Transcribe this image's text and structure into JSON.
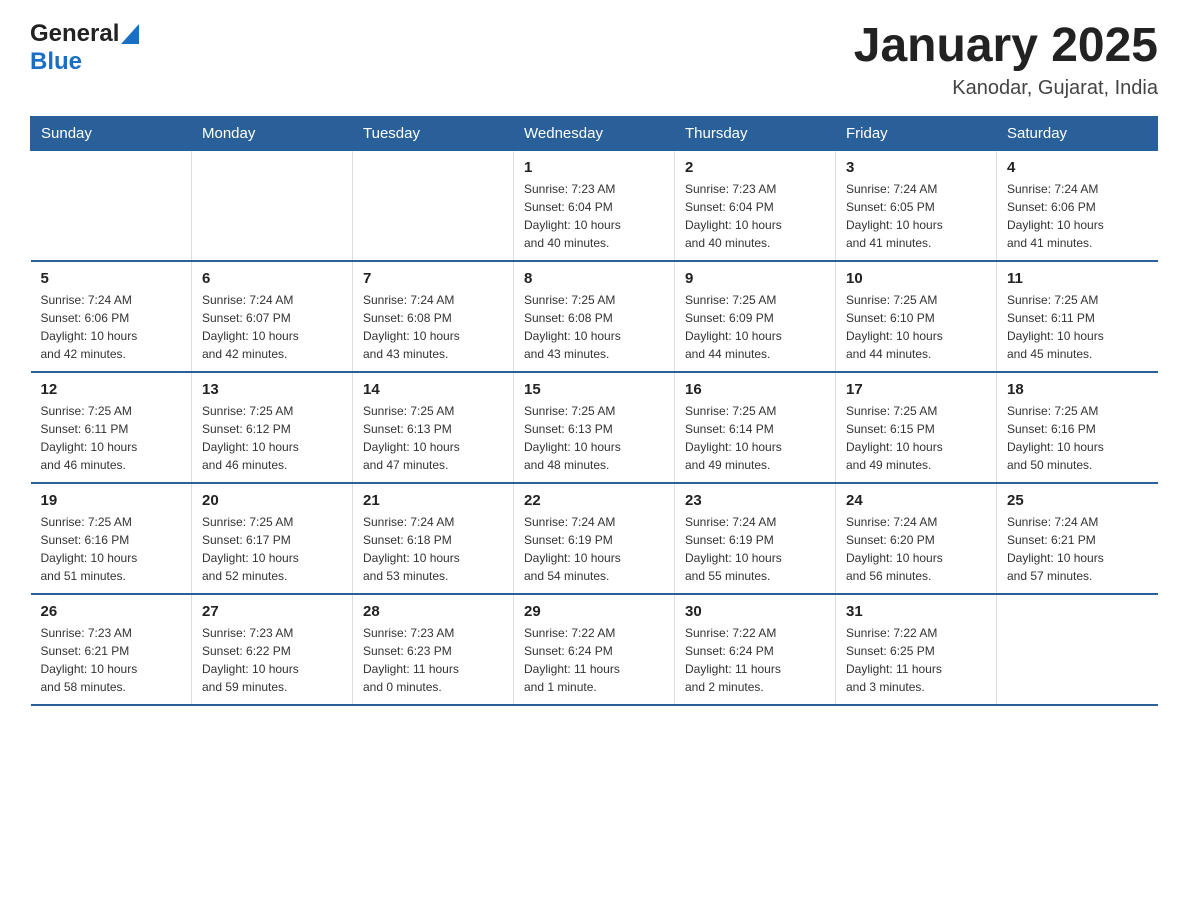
{
  "header": {
    "logo_general": "General",
    "logo_blue": "Blue",
    "title": "January 2025",
    "subtitle": "Kanodar, Gujarat, India"
  },
  "days_of_week": [
    "Sunday",
    "Monday",
    "Tuesday",
    "Wednesday",
    "Thursday",
    "Friday",
    "Saturday"
  ],
  "weeks": [
    [
      {
        "day": "",
        "info": ""
      },
      {
        "day": "",
        "info": ""
      },
      {
        "day": "",
        "info": ""
      },
      {
        "day": "1",
        "info": "Sunrise: 7:23 AM\nSunset: 6:04 PM\nDaylight: 10 hours\nand 40 minutes."
      },
      {
        "day": "2",
        "info": "Sunrise: 7:23 AM\nSunset: 6:04 PM\nDaylight: 10 hours\nand 40 minutes."
      },
      {
        "day": "3",
        "info": "Sunrise: 7:24 AM\nSunset: 6:05 PM\nDaylight: 10 hours\nand 41 minutes."
      },
      {
        "day": "4",
        "info": "Sunrise: 7:24 AM\nSunset: 6:06 PM\nDaylight: 10 hours\nand 41 minutes."
      }
    ],
    [
      {
        "day": "5",
        "info": "Sunrise: 7:24 AM\nSunset: 6:06 PM\nDaylight: 10 hours\nand 42 minutes."
      },
      {
        "day": "6",
        "info": "Sunrise: 7:24 AM\nSunset: 6:07 PM\nDaylight: 10 hours\nand 42 minutes."
      },
      {
        "day": "7",
        "info": "Sunrise: 7:24 AM\nSunset: 6:08 PM\nDaylight: 10 hours\nand 43 minutes."
      },
      {
        "day": "8",
        "info": "Sunrise: 7:25 AM\nSunset: 6:08 PM\nDaylight: 10 hours\nand 43 minutes."
      },
      {
        "day": "9",
        "info": "Sunrise: 7:25 AM\nSunset: 6:09 PM\nDaylight: 10 hours\nand 44 minutes."
      },
      {
        "day": "10",
        "info": "Sunrise: 7:25 AM\nSunset: 6:10 PM\nDaylight: 10 hours\nand 44 minutes."
      },
      {
        "day": "11",
        "info": "Sunrise: 7:25 AM\nSunset: 6:11 PM\nDaylight: 10 hours\nand 45 minutes."
      }
    ],
    [
      {
        "day": "12",
        "info": "Sunrise: 7:25 AM\nSunset: 6:11 PM\nDaylight: 10 hours\nand 46 minutes."
      },
      {
        "day": "13",
        "info": "Sunrise: 7:25 AM\nSunset: 6:12 PM\nDaylight: 10 hours\nand 46 minutes."
      },
      {
        "day": "14",
        "info": "Sunrise: 7:25 AM\nSunset: 6:13 PM\nDaylight: 10 hours\nand 47 minutes."
      },
      {
        "day": "15",
        "info": "Sunrise: 7:25 AM\nSunset: 6:13 PM\nDaylight: 10 hours\nand 48 minutes."
      },
      {
        "day": "16",
        "info": "Sunrise: 7:25 AM\nSunset: 6:14 PM\nDaylight: 10 hours\nand 49 minutes."
      },
      {
        "day": "17",
        "info": "Sunrise: 7:25 AM\nSunset: 6:15 PM\nDaylight: 10 hours\nand 49 minutes."
      },
      {
        "day": "18",
        "info": "Sunrise: 7:25 AM\nSunset: 6:16 PM\nDaylight: 10 hours\nand 50 minutes."
      }
    ],
    [
      {
        "day": "19",
        "info": "Sunrise: 7:25 AM\nSunset: 6:16 PM\nDaylight: 10 hours\nand 51 minutes."
      },
      {
        "day": "20",
        "info": "Sunrise: 7:25 AM\nSunset: 6:17 PM\nDaylight: 10 hours\nand 52 minutes."
      },
      {
        "day": "21",
        "info": "Sunrise: 7:24 AM\nSunset: 6:18 PM\nDaylight: 10 hours\nand 53 minutes."
      },
      {
        "day": "22",
        "info": "Sunrise: 7:24 AM\nSunset: 6:19 PM\nDaylight: 10 hours\nand 54 minutes."
      },
      {
        "day": "23",
        "info": "Sunrise: 7:24 AM\nSunset: 6:19 PM\nDaylight: 10 hours\nand 55 minutes."
      },
      {
        "day": "24",
        "info": "Sunrise: 7:24 AM\nSunset: 6:20 PM\nDaylight: 10 hours\nand 56 minutes."
      },
      {
        "day": "25",
        "info": "Sunrise: 7:24 AM\nSunset: 6:21 PM\nDaylight: 10 hours\nand 57 minutes."
      }
    ],
    [
      {
        "day": "26",
        "info": "Sunrise: 7:23 AM\nSunset: 6:21 PM\nDaylight: 10 hours\nand 58 minutes."
      },
      {
        "day": "27",
        "info": "Sunrise: 7:23 AM\nSunset: 6:22 PM\nDaylight: 10 hours\nand 59 minutes."
      },
      {
        "day": "28",
        "info": "Sunrise: 7:23 AM\nSunset: 6:23 PM\nDaylight: 11 hours\nand 0 minutes."
      },
      {
        "day": "29",
        "info": "Sunrise: 7:22 AM\nSunset: 6:24 PM\nDaylight: 11 hours\nand 1 minute."
      },
      {
        "day": "30",
        "info": "Sunrise: 7:22 AM\nSunset: 6:24 PM\nDaylight: 11 hours\nand 2 minutes."
      },
      {
        "day": "31",
        "info": "Sunrise: 7:22 AM\nSunset: 6:25 PM\nDaylight: 11 hours\nand 3 minutes."
      },
      {
        "day": "",
        "info": ""
      }
    ]
  ]
}
